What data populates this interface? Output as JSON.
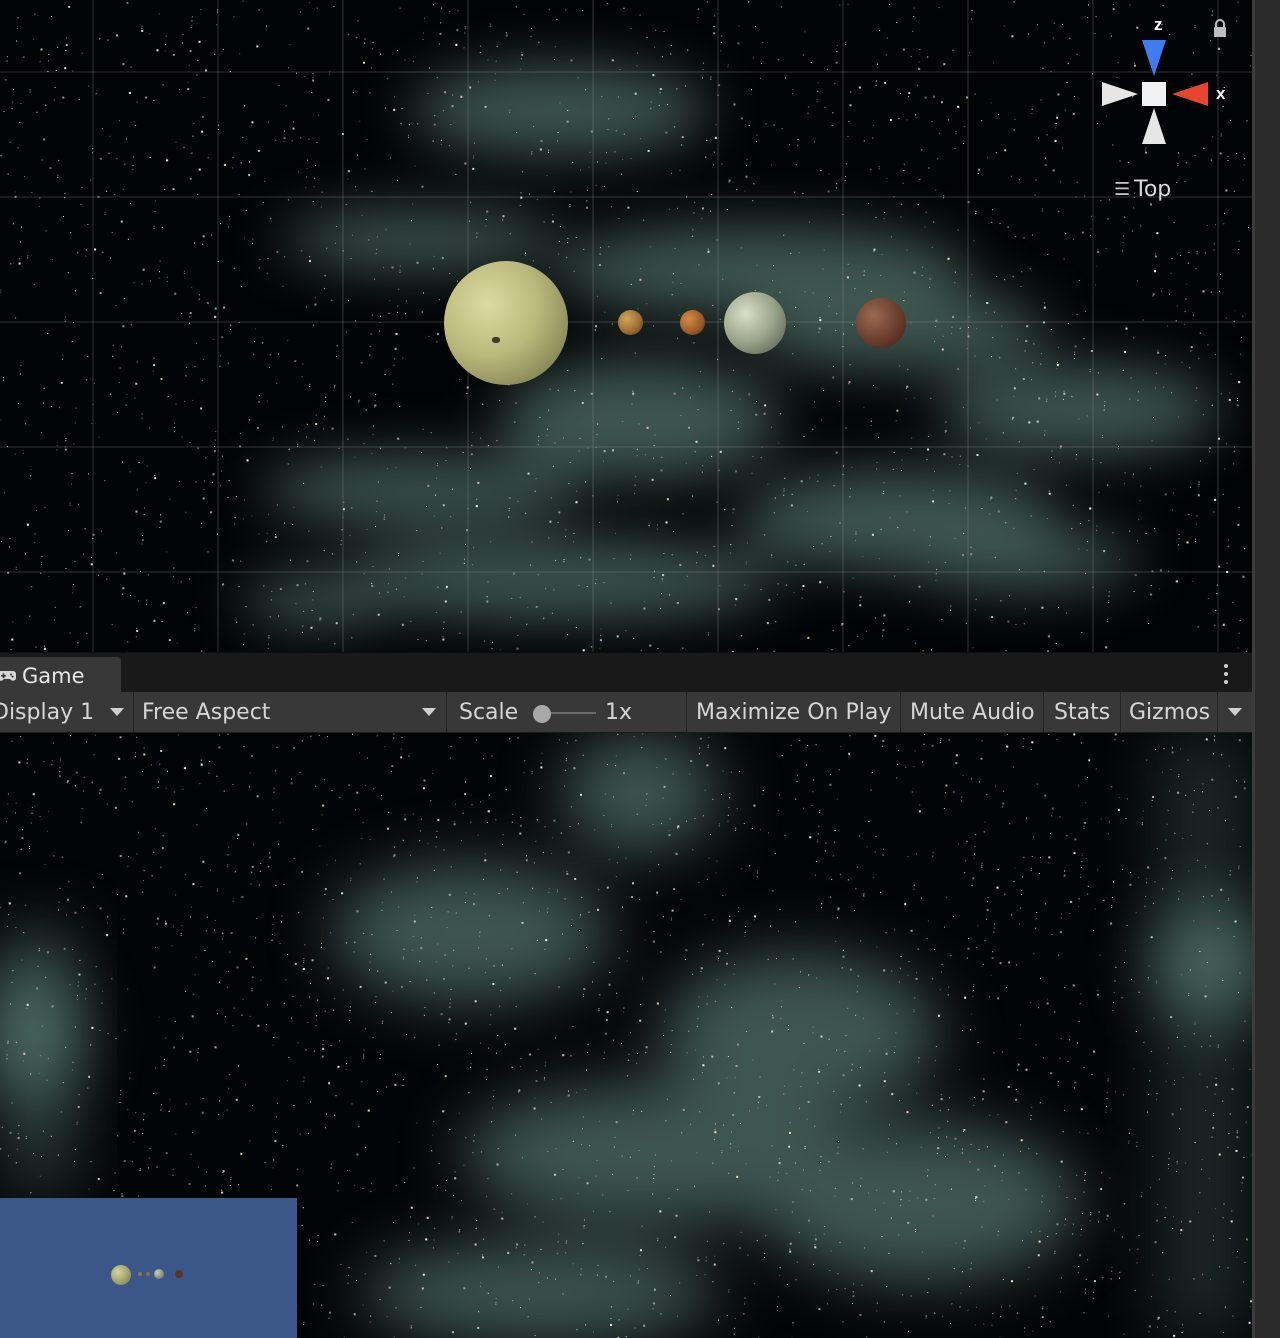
{
  "scene": {
    "gizmo": {
      "axis_z": "z",
      "axis_x": "x",
      "view_label": "Top",
      "icons": [
        "menu-icon",
        "lock-icon"
      ],
      "colors": {
        "z_axis": "#3f7cf0",
        "x_axis": "#e8452f",
        "neutral_axis": "#e6e6e6"
      }
    },
    "planets": [
      "planet-large-pale-yellow",
      "planet-small-orange",
      "planet-small-orange-red",
      "planet-medium-grey-green",
      "planet-medium-dark-red"
    ]
  },
  "game_panel": {
    "tab": {
      "label": "Game",
      "icon": "gamepad-icon"
    },
    "menu_icon": "kebab-menu-icon",
    "toolbar": {
      "display": "Display 1",
      "aspect": "Free Aspect",
      "scale_label": "Scale",
      "scale_value": "1x",
      "maximize_on_play": "Maximize On Play",
      "mute_audio": "Mute Audio",
      "stats": "Stats",
      "gizmos": "Gizmos"
    }
  },
  "colors": {
    "toolbar_bg": "#383838",
    "tabbar_bg": "#191919",
    "minimap_bg": "#3b5789",
    "space_bg": "#020304"
  }
}
